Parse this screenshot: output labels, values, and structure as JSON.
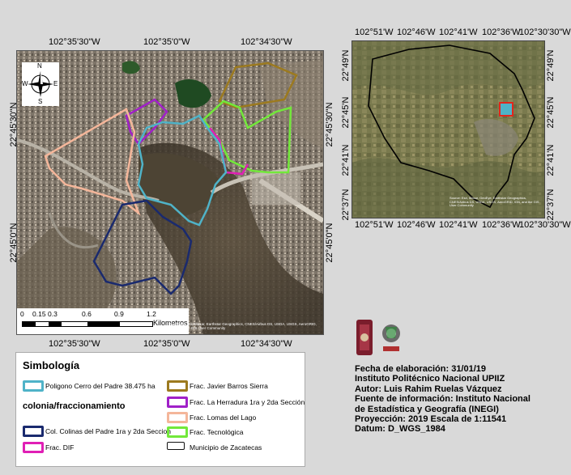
{
  "main_map": {
    "top_coords": [
      "102°35'30\"W",
      "102°35'0\"W",
      "102°34'30\"W"
    ],
    "bottom_coords": [
      "102°35'30\"W",
      "102°35'0\"W",
      "102°34'30\"W"
    ],
    "left_coords": [
      "22°45'30\"N",
      "22°45'0\"N"
    ],
    "right_coords": [
      "22°45'30\"N",
      "22°45'0\"N"
    ],
    "compass": {
      "n": "N",
      "s": "S",
      "e": "E",
      "w": "W"
    },
    "scale_ticks": [
      "0",
      "0.15",
      "0.3",
      "0.6",
      "0.9",
      "1.2"
    ],
    "scale_unit": "Kilometros",
    "attribution": "Zacatecas, EsriMaxar, Earthstar Geographics, CNES/Airbus DS, USDA, USGS, AeroGRID, IGN, and the GIS User Community"
  },
  "inset_map": {
    "top_coords": [
      "102°51'W",
      "102°46'W",
      "102°41'W",
      "102°36'W",
      "102°30'30\"W"
    ],
    "bottom_coords": [
      "102°51'W",
      "102°46'W",
      "102°41'W",
      "102°36'W",
      "102°30'30\"W"
    ],
    "left_coords": [
      "22°49'N",
      "22°45'N",
      "22°41'N",
      "22°37'N"
    ],
    "right_coords": [
      "22°49'N",
      "22°45'N",
      "22°41'N",
      "22°37'N"
    ],
    "attribution": "Source: Esri, Maxar, GeoEye, Earthstar Geographics, CNES/Airbus DS, USDA, USGS, AeroGRID, IGN, and the GIS User Community"
  },
  "legend": {
    "title": "Simbología",
    "subtitle": "colonia/fraccionamiento",
    "items": [
      {
        "label": "Poligono Cerro del Padre 38.475 ha",
        "color": "#4fb3c8"
      },
      {
        "label": "Col. Colinas del Padre 1ra y 2da Seccion",
        "color": "#1a2a6e"
      },
      {
        "label": "Frac. DIF",
        "color": "#e01fb5"
      },
      {
        "label": "Frac. Javier Barros Sierra",
        "color": "#9c7a1f"
      },
      {
        "label": "Frac. La Herradura 1ra y 2da Sección",
        "color": "#a020c8"
      },
      {
        "label": "Frac. Lomas del Lago",
        "color": "#f4b69a"
      },
      {
        "label": "Frac. Tecnológica",
        "color": "#72e83a"
      },
      {
        "label": "Municipio de Zacatecas",
        "color": "#111111"
      }
    ]
  },
  "logos": {
    "left_text": "IPN",
    "right_text": "UPIIZ"
  },
  "info": {
    "fecha": "Fecha de elaboración: 31/01/19",
    "institucion": "Instituto Politécnico Nacional UPIIZ",
    "autor": "Autor: Luis Rahim Ruelas Vázquez",
    "fuente1": "Fuente de información: Instituto Nacional",
    "fuente2": "de Estadística y Geografía (INEGI)",
    "proyeccion": "Proyección: 2019 Escala de 1:11541",
    "datum": "Datum:  D_WGS_1984"
  }
}
